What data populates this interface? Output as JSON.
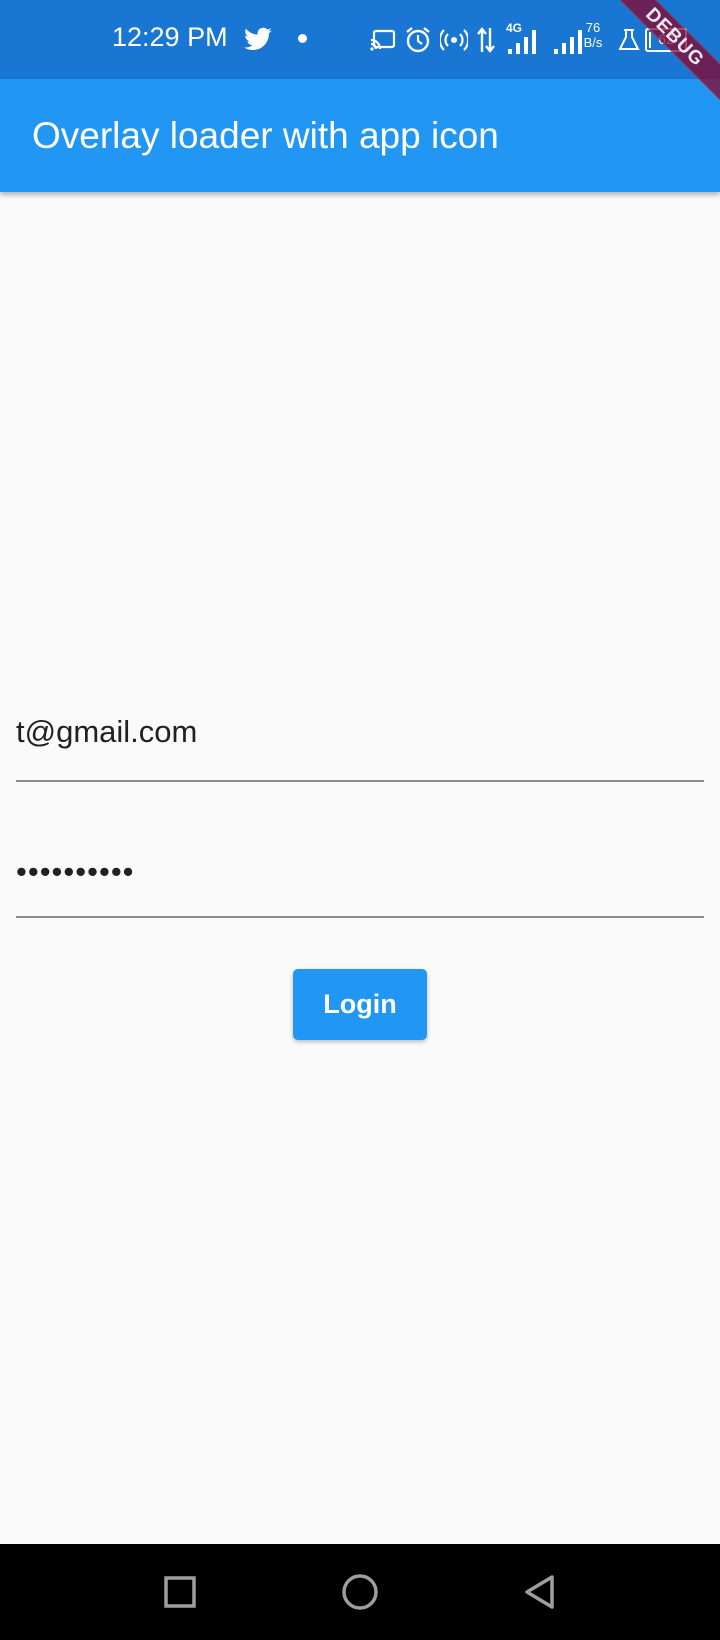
{
  "status_bar": {
    "time": "12:29 PM",
    "speed_value": "76",
    "speed_unit": "B/s",
    "network_label": "4G",
    "battery_level": "62",
    "icons": [
      "twitter-icon",
      "cast-icon",
      "alarm-icon",
      "hotspot-icon",
      "data-arrows-icon",
      "signal-icon",
      "signal-icon",
      "flask-icon",
      "battery-icon"
    ]
  },
  "debug_banner": "DEBUG",
  "app_bar": {
    "title": "Overlay loader with app icon"
  },
  "form": {
    "email_value": "t@gmail.com",
    "password_value": "••••••••••",
    "login_label": "Login"
  },
  "nav_bar": {
    "icons": [
      "recents-icon",
      "home-icon",
      "back-icon"
    ]
  },
  "colors": {
    "status_bar": "#1976d2",
    "app_bar": "#2196f3",
    "button": "#2196f3",
    "background": "#fafafa"
  }
}
